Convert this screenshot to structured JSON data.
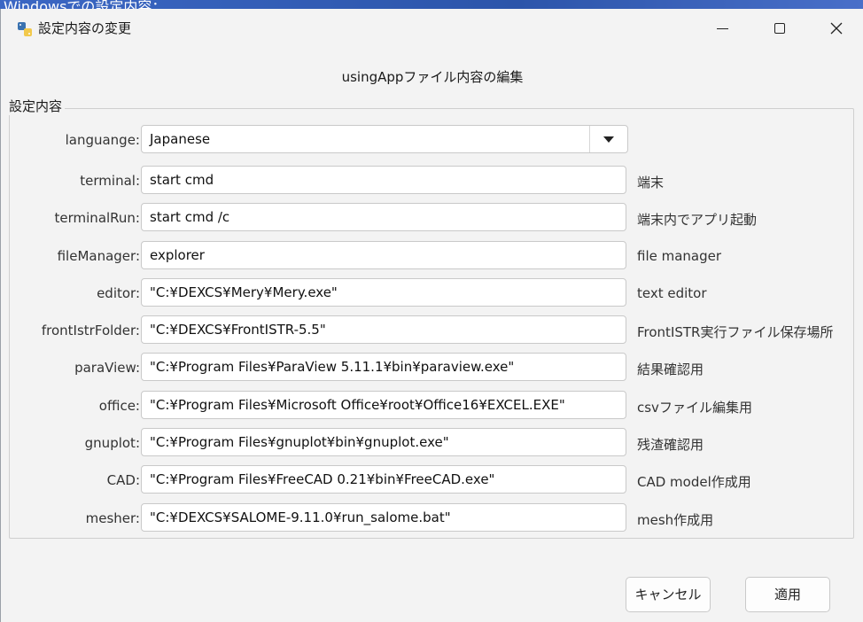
{
  "backdrop": {
    "text": "Windowsでの設定内容："
  },
  "window": {
    "title": "設定内容の変更"
  },
  "heading": "usingAppファイル内容の編集",
  "group": {
    "title": "設定内容"
  },
  "language": {
    "label": "languange:",
    "value": "Japanese"
  },
  "rows": [
    {
      "label": "terminal:",
      "value": "start cmd",
      "note": "端末"
    },
    {
      "label": "terminalRun:",
      "value": "start cmd /c",
      "note": "端末内でアプリ起動"
    },
    {
      "label": "fileManager:",
      "value": "explorer",
      "note": "file manager"
    },
    {
      "label": "editor:",
      "value": "\"C:¥DEXCS¥Mery¥Mery.exe\"",
      "note": "text editor"
    },
    {
      "label": "frontIstrFolder:",
      "value": "\"C:¥DEXCS¥FrontISTR-5.5\"",
      "note": "FrontISTR実行ファイル保存場所"
    },
    {
      "label": "paraView:",
      "value": "\"C:¥Program Files¥ParaView 5.11.1¥bin¥paraview.exe\"",
      "note": "結果確認用"
    },
    {
      "label": "office:",
      "value": "\"C:¥Program Files¥Microsoft Office¥root¥Office16¥EXCEL.EXE\"",
      "note": "csvファイル編集用"
    },
    {
      "label": "gnuplot:",
      "value": "\"C:¥Program Files¥gnuplot¥bin¥gnuplot.exe\"",
      "note": "残渣確認用"
    },
    {
      "label": "CAD:",
      "value": "\"C:¥Program Files¥FreeCAD 0.21¥bin¥FreeCAD.exe\"",
      "note": "CAD model作成用"
    },
    {
      "label": "mesher:",
      "value": "\"C:¥DEXCS¥SALOME-9.11.0¥run_salome.bat\"",
      "note": "mesh作成用"
    }
  ],
  "buttons": {
    "cancel": "キャンセル",
    "apply": "適用"
  },
  "icons": {
    "app": "python-icon",
    "minimize": "minimize-icon",
    "maximize": "maximize-icon",
    "close": "close-icon",
    "dropdown": "chevron-down-icon"
  },
  "colors": {
    "window_bg": "#f3f3f3",
    "backdrop": "#2a4f9c"
  }
}
